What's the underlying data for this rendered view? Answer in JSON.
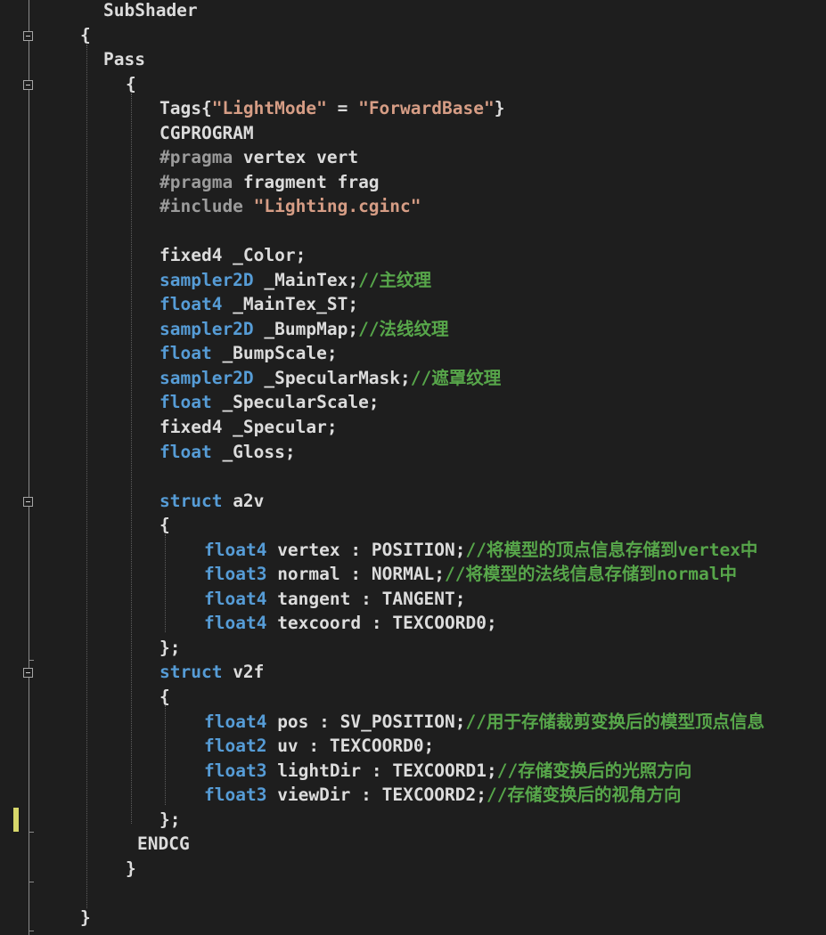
{
  "code": {
    "l1": "SubShader",
    "l2": "{",
    "l3": "Pass",
    "l4": "{",
    "l5": {
      "a": "Tags{",
      "b": "\"LightMode\"",
      "c": " = ",
      "d": "\"ForwardBase\"",
      "e": "}"
    },
    "l6": "CGPROGRAM",
    "l7": {
      "a": "#pragma",
      "b": " vertex vert"
    },
    "l8": {
      "a": "#pragma",
      "b": " fragment frag"
    },
    "l9": {
      "a": "#include",
      "b": " ",
      "c": "\"Lighting.cginc\""
    },
    "l11": "fixed4 _Color;",
    "l12": {
      "a": "sampler2D",
      "b": " _MainTex;",
      "c": "//主纹理"
    },
    "l13": {
      "a": "float4",
      "b": " _MainTex_ST;"
    },
    "l14": {
      "a": "sampler2D",
      "b": " _BumpMap;",
      "c": "//法线纹理"
    },
    "l15": {
      "a": "float",
      "b": " _BumpScale;"
    },
    "l16": {
      "a": "sampler2D",
      "b": " _SpecularMask;",
      "c": "//遮罩纹理"
    },
    "l17": {
      "a": "float",
      "b": " _SpecularScale;"
    },
    "l18": "fixed4 _Specular;",
    "l19": {
      "a": "float",
      "b": " _Gloss;"
    },
    "l21": {
      "a": "struct",
      "b": " a2v"
    },
    "l22": "{",
    "l23": {
      "a": "float4",
      "b": " vertex : POSITION;",
      "c": "//将模型的顶点信息存储到vertex中"
    },
    "l24": {
      "a": "float3",
      "b": " normal : NORMAL;",
      "c": "//将模型的法线信息存储到normal中"
    },
    "l25": {
      "a": "float4",
      "b": " tangent : TANGENT;"
    },
    "l26": {
      "a": "float4",
      "b": " texcoord : TEXCOORD0;"
    },
    "l27": "};",
    "l28": {
      "a": "struct",
      "b": " v2f"
    },
    "l29": "{",
    "l30": {
      "a": "float4",
      "b": " pos : SV_POSITION;",
      "c": "//用于存储裁剪变换后的模型顶点信息"
    },
    "l31": {
      "a": "float2",
      "b": " uv : TEXCOORD0;"
    },
    "l32": {
      "a": "float3",
      "b": " lightDir : TEXCOORD1;",
      "c": "//存储变换后的光照方向"
    },
    "l33": {
      "a": "float3",
      "b": " viewDir : TEXCOORD2;",
      "c": "//存储变换后的视角方向"
    },
    "l34": "};",
    "l35": "ENDCG",
    "l36": "}",
    "l38": "}"
  },
  "colors": {
    "background": "#1e1e1e",
    "keyword": "#569cd6",
    "string": "#d69d85",
    "comment": "#57a64a",
    "preprocessor": "#9b9b9b",
    "text": "#dcdcdc",
    "change_marker": "#d7d76a"
  },
  "icons": {
    "fold": "collapse-minus-icon"
  }
}
